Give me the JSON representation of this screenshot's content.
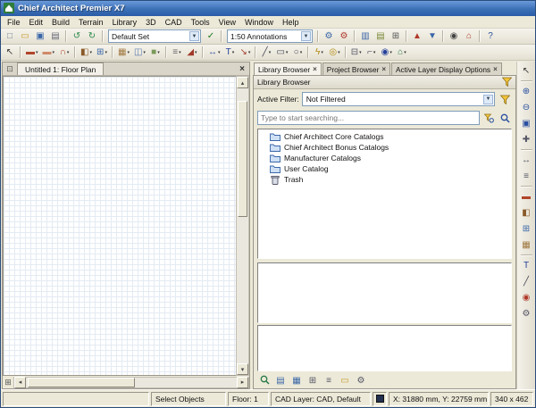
{
  "titlebar": {
    "title": "Chief Architect Premier X7"
  },
  "menubar": {
    "items": [
      {
        "label": "File"
      },
      {
        "label": "Edit"
      },
      {
        "label": "Build"
      },
      {
        "label": "Terrain"
      },
      {
        "label": "Library"
      },
      {
        "label": "3D"
      },
      {
        "label": "CAD"
      },
      {
        "label": "Tools"
      },
      {
        "label": "View"
      },
      {
        "label": "Window"
      },
      {
        "label": "Help"
      }
    ]
  },
  "toolbar1": {
    "items": [
      {
        "name": "new-plan-icon",
        "glyph": "□",
        "color": "#6b7f98"
      },
      {
        "name": "open-plan-icon",
        "glyph": "▭",
        "color": "#c89a28"
      },
      {
        "name": "save-plan-icon",
        "glyph": "▣",
        "color": "#3a66a8"
      },
      {
        "name": "print-icon",
        "glyph": "▤",
        "color": "#667"
      },
      {
        "sep": true
      },
      {
        "name": "undo-icon",
        "glyph": "↺",
        "color": "#2a8a4a"
      },
      {
        "name": "redo-icon",
        "glyph": "↻",
        "color": "#2a8a4a"
      },
      {
        "sep": true
      },
      {
        "combo": true,
        "name": "default-set-select",
        "value": "Default Set",
        "width": 104
      },
      {
        "name": "active-defaults-icon",
        "glyph": "✓",
        "color": "#1a7a1a"
      },
      {
        "sep": true
      },
      {
        "combo": true,
        "name": "annotation-set-select",
        "value": "1:50 Annotations",
        "width": 96
      },
      {
        "sep": true
      },
      {
        "name": "blue-wrench-icon",
        "glyph": "⚙",
        "color": "#3a66a8"
      },
      {
        "name": "red-wrench-icon",
        "glyph": "⚙",
        "color": "#b03a2a"
      },
      {
        "sep": true
      },
      {
        "name": "library-browser-icon",
        "glyph": "▥",
        "color": "#3a66a8"
      },
      {
        "name": "project-browser-icon",
        "glyph": "▤",
        "color": "#7a8a3a"
      },
      {
        "name": "layer-display-icon",
        "glyph": "⊞",
        "color": "#555"
      },
      {
        "sep": true
      },
      {
        "name": "floor-up-icon",
        "glyph": "▲",
        "color": "#b03a2a"
      },
      {
        "name": "floor-down-icon",
        "glyph": "▼",
        "color": "#3a66a8"
      },
      {
        "sep": true
      },
      {
        "name": "camera-icon",
        "glyph": "◉",
        "color": "#444"
      },
      {
        "name": "home-view-icon",
        "glyph": "⌂",
        "color": "#b03a2a"
      },
      {
        "sep": true
      },
      {
        "name": "help-icon",
        "glyph": "?",
        "color": "#2a50a0"
      }
    ]
  },
  "toolbar2": {
    "items": [
      {
        "name": "select-objects-icon",
        "glyph": "↖",
        "color": "#333"
      },
      {
        "sep": true
      },
      {
        "name": "straight-wall-icon",
        "glyph": "▬",
        "color": "#b0452a",
        "arrow": true
      },
      {
        "name": "interior-wall-icon",
        "glyph": "▬",
        "color": "#d08a6a",
        "arrow": true
      },
      {
        "name": "curved-wall-icon",
        "glyph": "∩",
        "color": "#b0452a",
        "arrow": true
      },
      {
        "sep": true
      },
      {
        "name": "door-icon",
        "glyph": "◧",
        "color": "#8a5a2a",
        "arrow": true
      },
      {
        "name": "window-icon",
        "glyph": "⊞",
        "color": "#3a66a8",
        "arrow": true
      },
      {
        "sep": true
      },
      {
        "name": "cabinet-icon",
        "glyph": "▦",
        "color": "#a07840",
        "arrow": true
      },
      {
        "name": "fixture-icon",
        "glyph": "◫",
        "color": "#5a7ab0",
        "arrow": true
      },
      {
        "name": "furniture-icon",
        "glyph": "■",
        "color": "#7a9a5a",
        "arrow": true
      },
      {
        "sep": true
      },
      {
        "name": "stairs-icon",
        "glyph": "≡",
        "color": "#666",
        "arrow": true
      },
      {
        "name": "roof-icon",
        "glyph": "◢",
        "color": "#a03a2a",
        "arrow": true
      },
      {
        "sep": true
      },
      {
        "name": "dimension-icon",
        "glyph": "↔",
        "color": "#35529a",
        "arrow": true
      },
      {
        "name": "text-icon",
        "glyph": "T",
        "color": "#24409a",
        "arrow": true
      },
      {
        "name": "leader-line-icon",
        "glyph": "↘",
        "color": "#a03a2a",
        "arrow": true
      },
      {
        "sep": true
      },
      {
        "name": "cad-line-icon",
        "glyph": "╱",
        "color": "#445",
        "arrow": true
      },
      {
        "name": "cad-box-icon",
        "glyph": "▭",
        "color": "#445",
        "arrow": true
      },
      {
        "name": "cad-circle-icon",
        "glyph": "○",
        "color": "#445",
        "arrow": true
      },
      {
        "sep": true
      },
      {
        "name": "electrical-icon",
        "glyph": "ϟ",
        "color": "#b08a10",
        "arrow": true
      },
      {
        "name": "light-fixture-icon",
        "glyph": "◎",
        "color": "#b08a10",
        "arrow": true
      },
      {
        "sep": true
      },
      {
        "name": "cross-section-icon",
        "glyph": "⊟",
        "color": "#556",
        "arrow": true
      },
      {
        "name": "elevation-icon",
        "glyph": "⌐",
        "color": "#556",
        "arrow": true
      },
      {
        "name": "camera-view-icon",
        "glyph": "◉",
        "color": "#24409a",
        "arrow": true
      },
      {
        "name": "overview-3d-icon",
        "glyph": "⌂",
        "color": "#2a7a4a",
        "arrow": true
      }
    ]
  },
  "drawing": {
    "tab_label": "Untitled 1: Floor Plan"
  },
  "library": {
    "tabs": [
      {
        "label": "Library Browser",
        "active": true
      },
      {
        "label": "Project Browser",
        "active": false
      },
      {
        "label": "Active Layer Display Options",
        "active": false
      }
    ],
    "panel_title": "Library Browser",
    "filter_label": "Active Filter:",
    "filter_value": "Not Filtered",
    "search_placeholder": "Type to start searching...",
    "tree": [
      {
        "label": "Chief Architect Core Catalogs",
        "icon": "folder"
      },
      {
        "label": "Chief Architect Bonus Catalogs",
        "icon": "folder"
      },
      {
        "label": "Manufacturer Catalogs",
        "icon": "folder"
      },
      {
        "label": "User Catalog",
        "icon": "folder"
      },
      {
        "label": "Trash",
        "icon": "trash"
      }
    ],
    "bottom_icons": [
      {
        "name": "library-search-icon",
        "svg": "mag"
      },
      {
        "name": "preview-pane-icon",
        "glyph": "▤",
        "color": "#3a66a8"
      },
      {
        "name": "details-pane-icon",
        "glyph": "▦",
        "color": "#3a66a8"
      },
      {
        "name": "tile-view-icon",
        "glyph": "⊞",
        "color": "#556"
      },
      {
        "name": "list-view-icon",
        "glyph": "≡",
        "color": "#556"
      },
      {
        "name": "open-catalog-icon",
        "glyph": "▭",
        "color": "#c89a28"
      },
      {
        "name": "library-settings-icon",
        "glyph": "⚙",
        "color": "#556"
      }
    ]
  },
  "side_toolbar": {
    "items": [
      {
        "name": "side-select-arrow-icon",
        "glyph": "↖",
        "color": "#333"
      },
      {
        "sep": true
      },
      {
        "name": "zoom-in-icon",
        "glyph": "⊕",
        "color": "#2a50a0"
      },
      {
        "name": "zoom-out-icon",
        "glyph": "⊖",
        "color": "#2a50a0"
      },
      {
        "name": "fill-window-icon",
        "glyph": "▣",
        "color": "#2a50a0"
      },
      {
        "name": "pan-icon",
        "glyph": "✚",
        "color": "#556"
      },
      {
        "sep": true
      },
      {
        "name": "tape-measure-icon",
        "glyph": "↔",
        "color": "#556"
      },
      {
        "name": "side-dimension-icon",
        "glyph": "≡",
        "color": "#556"
      },
      {
        "sep": true
      },
      {
        "name": "side-wall-icon",
        "glyph": "▬",
        "color": "#b0452a"
      },
      {
        "name": "side-door-icon",
        "glyph": "◧",
        "color": "#8a5a2a"
      },
      {
        "name": "side-window-icon",
        "glyph": "⊞",
        "color": "#3a66a8"
      },
      {
        "name": "side-cabinet-icon",
        "glyph": "▦",
        "color": "#a07840"
      },
      {
        "sep": true
      },
      {
        "name": "side-text-icon",
        "glyph": "T",
        "color": "#24409a"
      },
      {
        "name": "side-cad-icon",
        "glyph": "╱",
        "color": "#445"
      },
      {
        "name": "side-camera-icon",
        "glyph": "◉",
        "color": "#b03a2a"
      },
      {
        "name": "side-settings-icon",
        "glyph": "⚙",
        "color": "#556"
      }
    ]
  },
  "statusbar": {
    "hint": "",
    "tool": "Select Objects",
    "floor": "Floor: 1",
    "layer": "CAD Layer: CAD,  Default",
    "coords": "X: 31880 mm, Y: 22759 mm,",
    "size": "340 x 462"
  }
}
